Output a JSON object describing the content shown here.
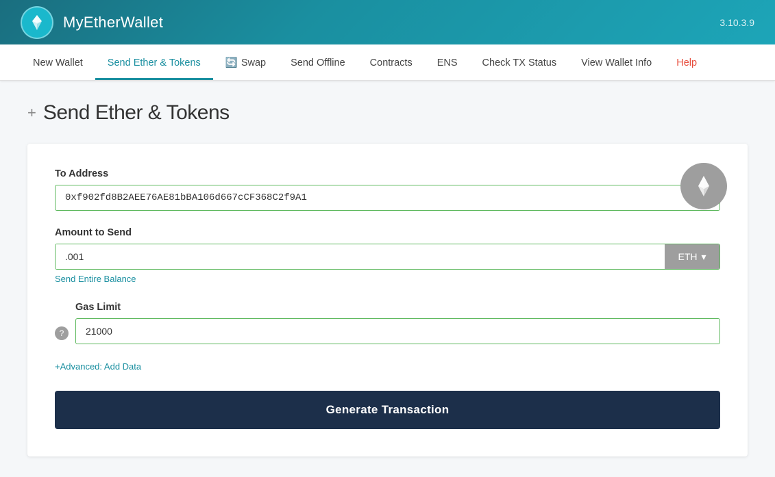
{
  "app": {
    "title": "MyEtherWallet",
    "version": "3.10.3.9"
  },
  "nav": {
    "items": [
      {
        "id": "new-wallet",
        "label": "New Wallet",
        "active": false
      },
      {
        "id": "send-ether-tokens",
        "label": "Send Ether & Tokens",
        "active": true
      },
      {
        "id": "swap",
        "label": "Swap",
        "active": false,
        "hasIcon": true
      },
      {
        "id": "send-offline",
        "label": "Send Offline",
        "active": false
      },
      {
        "id": "contracts",
        "label": "Contracts",
        "active": false
      },
      {
        "id": "ens",
        "label": "ENS",
        "active": false
      },
      {
        "id": "check-tx-status",
        "label": "Check TX Status",
        "active": false
      },
      {
        "id": "view-wallet-info",
        "label": "View Wallet Info",
        "active": false
      },
      {
        "id": "help",
        "label": "Help",
        "active": false,
        "isHelp": true
      }
    ]
  },
  "page": {
    "plus_symbol": "+",
    "title": "Send Ether & Tokens"
  },
  "form": {
    "to_address_label": "To Address",
    "to_address_value": "0xf902fd8B2AEE76AE81bBA106d667cCF368C2f9A1",
    "amount_label": "Amount to Send",
    "amount_value": ".001",
    "token_label": "ETH",
    "token_dropdown_arrow": "▾",
    "send_entire_balance": "Send Entire Balance",
    "gas_limit_label": "Gas Limit",
    "gas_limit_value": "21000",
    "advanced_link": "+Advanced: Add Data",
    "generate_button": "Generate Transaction",
    "help_tooltip": "?"
  }
}
